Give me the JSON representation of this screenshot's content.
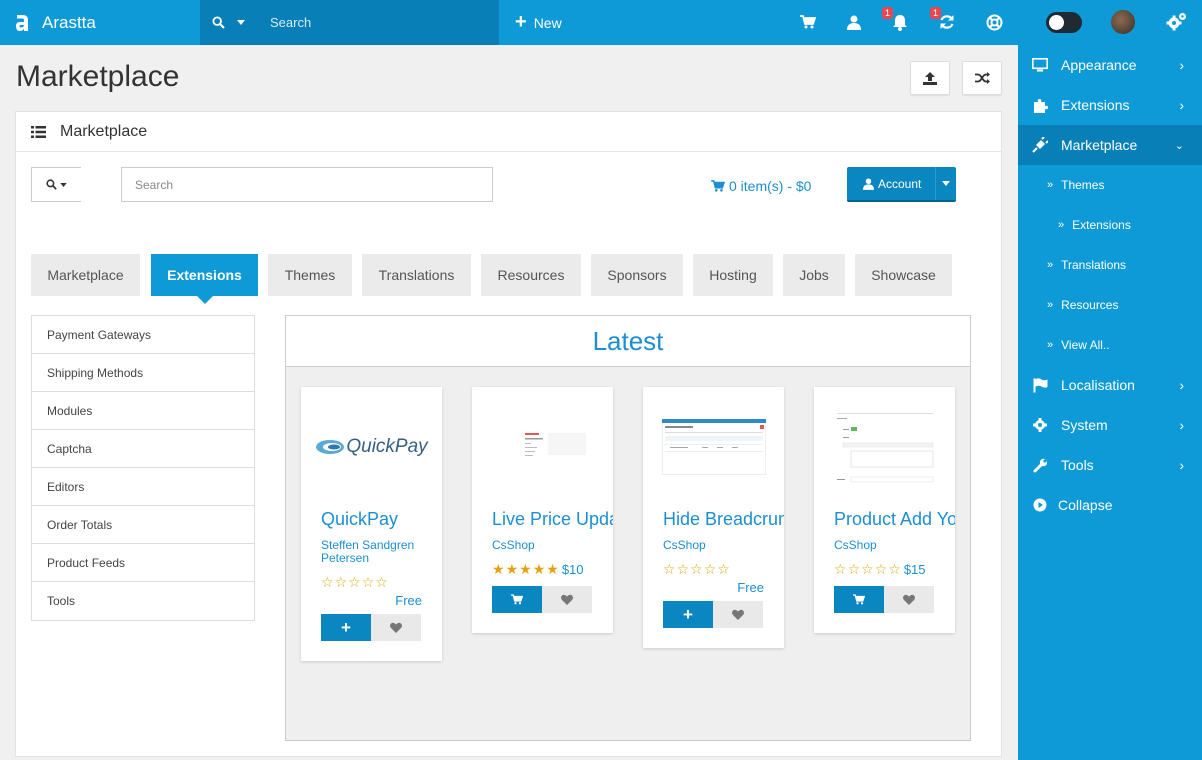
{
  "topbar": {
    "brand": "Arastta",
    "search_placeholder": "Search",
    "new_label": "New",
    "notifications_badge": "1",
    "updates_badge": "1"
  },
  "page": {
    "title": "Marketplace"
  },
  "panel": {
    "title": "Marketplace",
    "search_placeholder": "Search",
    "cart_text": "0 item(s) - $0",
    "account_label": "Account"
  },
  "tabs": [
    {
      "label": "Marketplace",
      "active": false
    },
    {
      "label": "Extensions",
      "active": true
    },
    {
      "label": "Themes",
      "active": false
    },
    {
      "label": "Translations",
      "active": false
    },
    {
      "label": "Resources",
      "active": false
    },
    {
      "label": "Sponsors",
      "active": false
    },
    {
      "label": "Hosting",
      "active": false
    },
    {
      "label": "Jobs",
      "active": false
    },
    {
      "label": "Showcase",
      "active": false
    }
  ],
  "categories": [
    "Payment Gateways",
    "Shipping Methods",
    "Modules",
    "Captcha",
    "Editors",
    "Order Totals",
    "Product Feeds",
    "Tools"
  ],
  "latest": {
    "heading": "Latest",
    "products": [
      {
        "name": "QuickPay",
        "author": "Steffen Sandgren Petersen",
        "rating": 0,
        "price": "Free",
        "logo_text": "QuickPay"
      },
      {
        "name": "Live Price Update",
        "author": "CsShop",
        "rating": 5,
        "price": "$10"
      },
      {
        "name": "Hide Breadcrumb",
        "author": "CsShop",
        "rating": 0,
        "price": "Free"
      },
      {
        "name": "Product Add Youtube",
        "author": "CsShop",
        "rating": 0,
        "price": "$15"
      }
    ]
  },
  "sidebar": {
    "items": [
      {
        "label": "Appearance",
        "icon": "monitor-icon"
      },
      {
        "label": "Extensions",
        "icon": "puzzle-icon"
      },
      {
        "label": "Marketplace",
        "icon": "plug-icon",
        "active": true
      },
      {
        "label": "Localisation",
        "icon": "flag-icon"
      },
      {
        "label": "System",
        "icon": "cog-icon"
      },
      {
        "label": "Tools",
        "icon": "wrench-icon"
      },
      {
        "label": "Collapse",
        "icon": "play-circle-icon"
      }
    ],
    "subitems": [
      {
        "label": "Themes",
        "level": 1
      },
      {
        "label": "Extensions",
        "level": 2
      },
      {
        "label": "Translations",
        "level": 1
      },
      {
        "label": "Resources",
        "level": 1
      },
      {
        "label": "View All..",
        "level": 1
      }
    ]
  },
  "colors": {
    "primary": "#0d9ad6",
    "primary_dark": "#087fb6",
    "link": "#1c8fd1",
    "star": "#e0a412",
    "badge": "#e8474f"
  }
}
